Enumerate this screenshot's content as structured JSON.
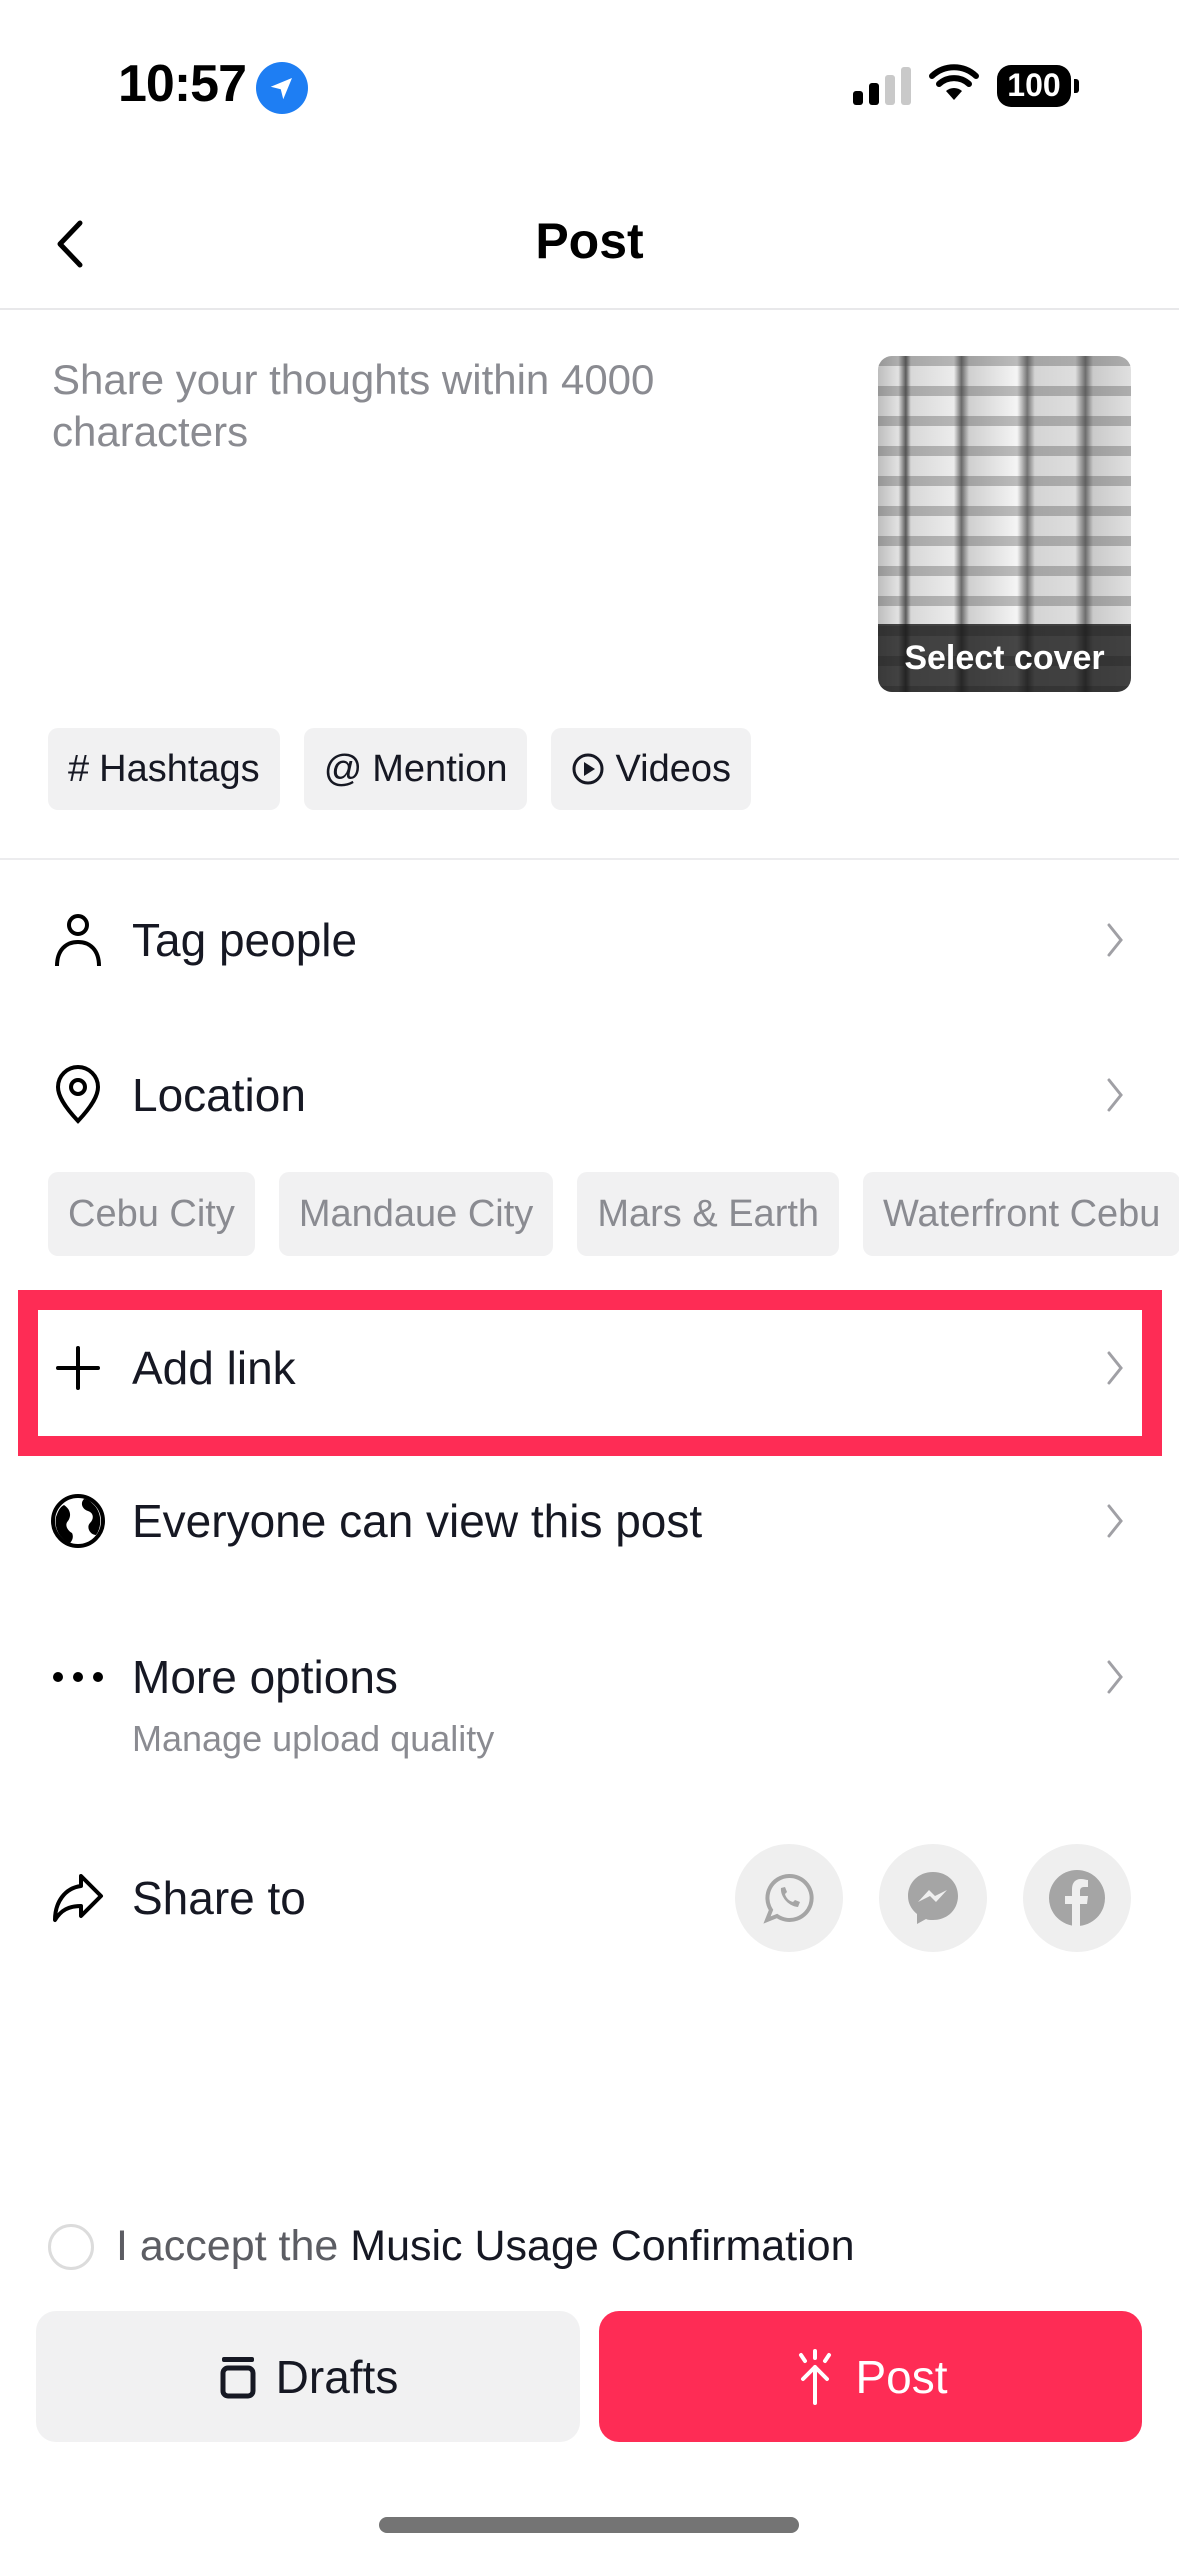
{
  "status_bar": {
    "time": "10:57",
    "location_icon": "location-arrow-icon",
    "signal_icon": "cellular-signal-icon",
    "signal_bars_active": 2,
    "signal_bars_total": 4,
    "wifi_icon": "wifi-icon",
    "battery_level": "100"
  },
  "header": {
    "title": "Post",
    "back_icon": "chevron-left-icon"
  },
  "compose": {
    "caption_placeholder": "Share your thoughts within 4000 characters",
    "cover_label": "Select cover",
    "chips": [
      {
        "symbol": "#",
        "label": "Hashtags",
        "icon": "hashtag-icon"
      },
      {
        "symbol": "@",
        "label": "Mention",
        "icon": "at-icon"
      },
      {
        "symbol": "",
        "label": "Videos",
        "icon": "play-circle-icon"
      }
    ]
  },
  "settings": {
    "tag_people": {
      "label": "Tag people",
      "icon": "person-icon"
    },
    "location": {
      "label": "Location",
      "icon": "location-pin-icon"
    },
    "location_suggestions": [
      "Cebu City",
      "Mandaue City",
      "Mars & Earth",
      "Waterfront Cebu"
    ],
    "add_link": {
      "label": "Add link",
      "icon": "plus-icon"
    },
    "privacy": {
      "label": "Everyone can view this post",
      "icon": "globe-icon"
    },
    "more_options": {
      "label": "More options",
      "sublabel": "Manage upload quality",
      "icon": "more-dots-icon"
    },
    "share_to": {
      "label": "Share to",
      "icon": "share-arrow-icon",
      "targets": [
        {
          "name": "WhatsApp",
          "icon": "whatsapp-icon"
        },
        {
          "name": "Messenger",
          "icon": "messenger-icon"
        },
        {
          "name": "Facebook",
          "icon": "facebook-icon"
        }
      ]
    }
  },
  "footer": {
    "accept_prefix": "I accept the",
    "accept_link": "Music Usage Confirmation",
    "drafts_label": "Drafts",
    "post_label": "Post"
  },
  "colors": {
    "accent": "#fe2c55",
    "highlight_box": "#fe2c55",
    "chip_bg": "#f1f1f2",
    "secondary_text": "#8a8b91",
    "location_badge": "#1e7ef3"
  }
}
